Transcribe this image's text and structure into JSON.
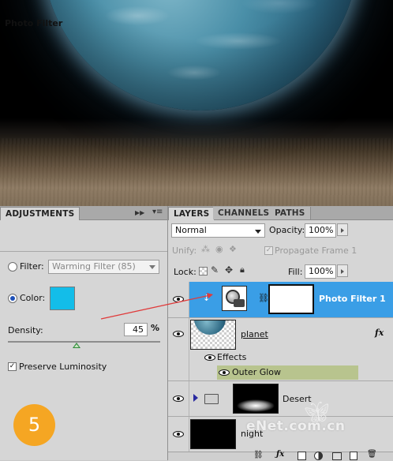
{
  "colors": {
    "accent_selection": "#3a9ee6",
    "photo_filter_color": "#13bde9",
    "outer_glow_row": "#b8c48e",
    "step_badge": "#f5a623",
    "annotation_arrow": "#e03a3a"
  },
  "adjustments": {
    "tab_label": "ADJUSTMENTS",
    "title": "Photo Filter",
    "filter_label": "Filter:",
    "filter_value": "Warming Filter (85)",
    "filter_selected": false,
    "color_label": "Color:",
    "color_selected": true,
    "density_label": "Density:",
    "density_value": "45",
    "density_unit": "%",
    "density_level_percent": 45,
    "preserve_luminosity_label": "Preserve Luminosity",
    "preserve_luminosity_checked": true
  },
  "step_badge": {
    "number": "5"
  },
  "layers_panel": {
    "tabs": [
      "LAYERS",
      "CHANNELS",
      "PATHS"
    ],
    "blend_mode": "Normal",
    "opacity_label": "Opacity:",
    "opacity_value": "100%",
    "unify_label": "Unify:",
    "propagate_label": "Propagate Frame 1",
    "lock_label": "Lock:",
    "fill_label": "Fill:",
    "fill_value": "100%",
    "layers": [
      {
        "name": "Photo Filter 1",
        "selected": true,
        "visible": true
      },
      {
        "name": "planet",
        "visible": true,
        "fx_badge": "fx"
      },
      {
        "name": "Desert",
        "visible": true,
        "is_group": true
      },
      {
        "name": "night",
        "visible": true
      }
    ],
    "effects_label": "Effects",
    "outer_glow_label": "Outer Glow"
  },
  "watermark": {
    "text": "eNet.com.cn"
  }
}
